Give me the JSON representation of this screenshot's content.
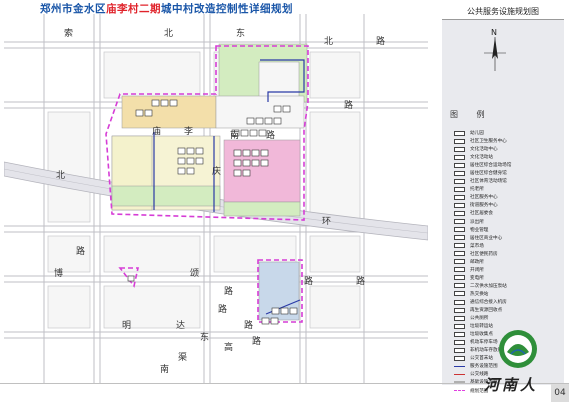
{
  "title": {
    "prefix": "郑州市金水区",
    "highlight": "庙李村二期",
    "suffix": "城中村改造控制性详细规划"
  },
  "panel": {
    "header": "公共服务设施规划图",
    "legend_heading": "图 例",
    "legend_items": [
      {
        "label": "幼儿园",
        "style": "box"
      },
      {
        "label": "社区卫生服务中心",
        "style": "box"
      },
      {
        "label": "文化活动中心",
        "style": "box"
      },
      {
        "label": "文化活动站",
        "style": "box"
      },
      {
        "label": "居住区综合运动场馆",
        "style": "box"
      },
      {
        "label": "居住区综合健身馆",
        "style": "box"
      },
      {
        "label": "社区体育活动场馆",
        "style": "box"
      },
      {
        "label": "托老所",
        "style": "box"
      },
      {
        "label": "社区服务中心",
        "style": "box"
      },
      {
        "label": "街道服务中心",
        "style": "box"
      },
      {
        "label": "社区居委会",
        "style": "box"
      },
      {
        "label": "派出所",
        "style": "box"
      },
      {
        "label": "物业管理",
        "style": "box"
      },
      {
        "label": "居住区商业中心",
        "style": "box"
      },
      {
        "label": "菜市场",
        "style": "box"
      },
      {
        "label": "社区便民药房",
        "style": "box"
      },
      {
        "label": "邮政所",
        "style": "box"
      },
      {
        "label": "开闭所",
        "style": "box"
      },
      {
        "label": "变电所",
        "style": "box"
      },
      {
        "label": "二次供水加压泵站",
        "style": "box"
      },
      {
        "label": "热交换站",
        "style": "box"
      },
      {
        "label": "通信综合接入机房",
        "style": "box"
      },
      {
        "label": "再生资源回收点",
        "style": "box"
      },
      {
        "label": "公共厕所",
        "style": "box"
      },
      {
        "label": "垃圾转运站",
        "style": "box"
      },
      {
        "label": "垃圾收集点",
        "style": "box"
      },
      {
        "label": "机动车停车场",
        "style": "box"
      },
      {
        "label": "非机动车存放处",
        "style": "box"
      },
      {
        "label": "公交首末站",
        "style": "box"
      },
      {
        "label": "服务设施范围",
        "style": "line"
      },
      {
        "label": "公交线路",
        "style": "red"
      },
      {
        "label": "基础设施走廊",
        "style": "gray"
      },
      {
        "label": "规划范围",
        "style": "dash"
      }
    ],
    "footer_text": "河南人",
    "page_number": "04"
  },
  "map": {
    "north_label": "N",
    "road_chars": [
      {
        "text": "索"
      },
      {
        "text": "东"
      },
      {
        "text": "北"
      },
      {
        "text": "路"
      },
      {
        "text": "庙"
      },
      {
        "text": "李"
      },
      {
        "text": "南"
      },
      {
        "text": "路"
      },
      {
        "text": "庆"
      },
      {
        "text": "路"
      },
      {
        "text": "北"
      },
      {
        "text": "环"
      },
      {
        "text": "路"
      },
      {
        "text": "博"
      },
      {
        "text": "颂"
      },
      {
        "text": "路"
      },
      {
        "text": "明"
      },
      {
        "text": "达"
      },
      {
        "text": "路"
      },
      {
        "text": "东"
      },
      {
        "text": "高"
      },
      {
        "text": "路"
      },
      {
        "text": "路"
      },
      {
        "text": "北"
      },
      {
        "text": "路"
      },
      {
        "text": "路"
      },
      {
        "text": "渠"
      },
      {
        "text": "南"
      }
    ]
  },
  "colors": {
    "title_blue": "#1a56a8",
    "title_red": "#e0232b",
    "boundary_dash": "#d63dd6",
    "service_line": "#2a3aa6",
    "residential_yellow": "#f3dfaa",
    "commercial_pink": "#f1b8d9",
    "green_space": "#d3ecc0",
    "road_gray": "#cfcfd4"
  }
}
